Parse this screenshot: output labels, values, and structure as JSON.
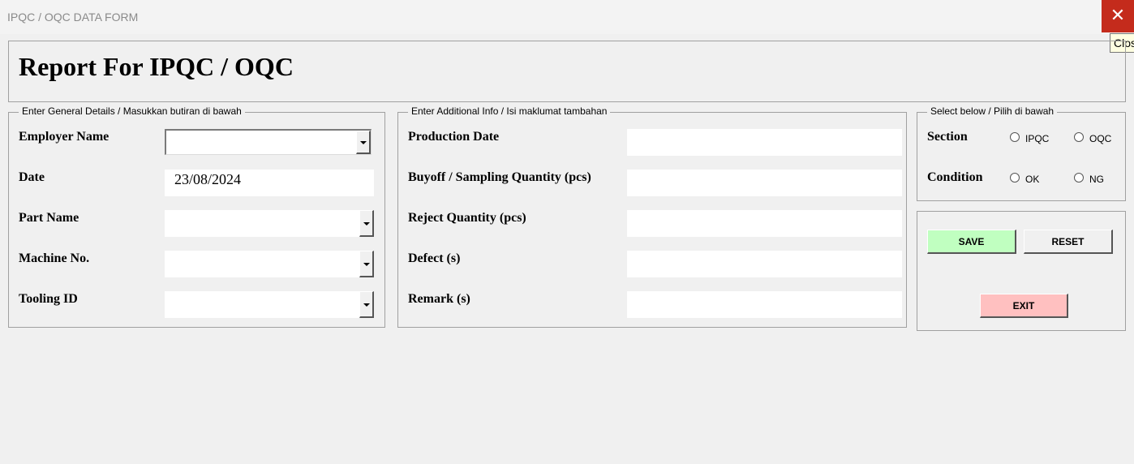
{
  "window": {
    "title": "IPQC / OQC DATA FORM",
    "close_tooltip": "Close"
  },
  "header": {
    "title": "Report For IPQC / OQC"
  },
  "general": {
    "caption": "Enter General Details / Masukkan butiran di bawah",
    "employer_label": "Employer Name",
    "date_label": "Date",
    "date_value": "23/08/2024",
    "part_label": "Part Name",
    "machine_label": "Machine No.",
    "tooling_label": "Tooling ID"
  },
  "additional": {
    "caption": "Enter Additional Info / Isi maklumat tambahan",
    "production_date_label": "Production Date",
    "buyoff_label": "Buyoff / Sampling Quantity (pcs)",
    "reject_label": "Reject Quantity (pcs)",
    "defect_label": "Defect (s)",
    "remark_label": "Remark (s)"
  },
  "select": {
    "caption": "Select below / Pilih di bawah",
    "section_label": "Section",
    "section_options": [
      "IPQC",
      "OQC"
    ],
    "condition_label": "Condition",
    "condition_options": [
      "OK",
      "NG"
    ]
  },
  "actions": {
    "save": "SAVE",
    "reset": "RESET",
    "exit": "EXIT"
  },
  "colors": {
    "save": "#c0ffc0",
    "exit": "#ffc0c0",
    "close": "#c42b1c"
  }
}
